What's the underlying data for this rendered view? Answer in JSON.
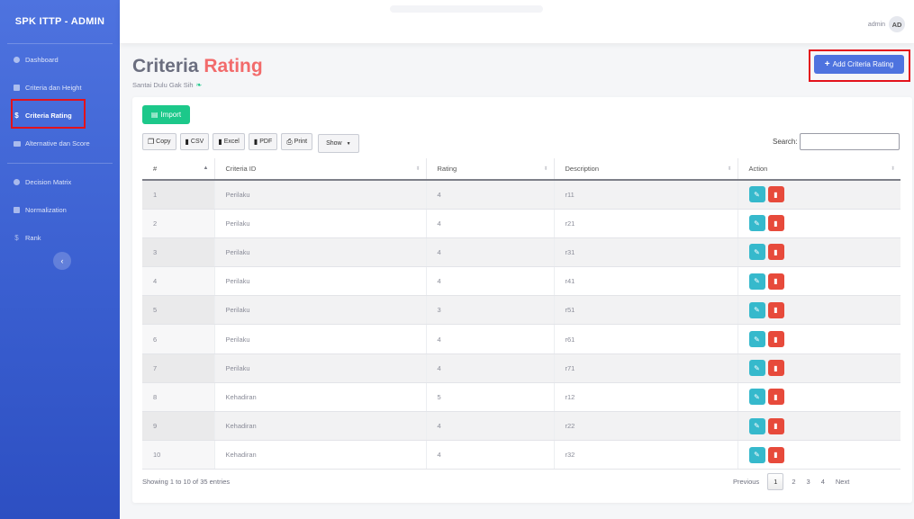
{
  "brand": "SPK ITTP - ADMIN",
  "sidebar": {
    "items": [
      {
        "label": "Dashboard",
        "icon": "dashboard-icon"
      },
      {
        "label": "Criteria dan Height",
        "icon": "table-icon"
      },
      {
        "label": "Criteria Rating",
        "icon": "dollar-icon"
      },
      {
        "label": "Alternative dan Score",
        "icon": "card-icon"
      },
      {
        "label": "Decision Matrix",
        "icon": "matrix-icon"
      },
      {
        "label": "Normalization",
        "icon": "table-icon"
      },
      {
        "label": "Rank",
        "icon": "dollar-icon"
      }
    ],
    "active": "Criteria Rating",
    "toggle_glyph": "‹"
  },
  "topbar": {
    "user_name": "admin",
    "avatar_initials": "AD"
  },
  "header": {
    "title_part1": "Criteria",
    "title_part2": "Rating",
    "subtitle": "Santai Dulu Gak Sih",
    "add_label": "Add Criteria Rating"
  },
  "toolbar": {
    "import_label": "Import",
    "buttons": [
      "Copy",
      "CSV",
      "Excel",
      "PDF",
      "Print"
    ],
    "show_label": "Show",
    "search_label": "Search:",
    "search_value": ""
  },
  "table": {
    "columns": [
      "#",
      "Criteria ID",
      "Rating",
      "Description",
      "Action"
    ],
    "rows": [
      {
        "no": "1",
        "criteria": "Perilaku",
        "rating": "4",
        "desc": "r11"
      },
      {
        "no": "2",
        "criteria": "Perilaku",
        "rating": "4",
        "desc": "r21"
      },
      {
        "no": "3",
        "criteria": "Perilaku",
        "rating": "4",
        "desc": "r31"
      },
      {
        "no": "4",
        "criteria": "Perilaku",
        "rating": "4",
        "desc": "r41"
      },
      {
        "no": "5",
        "criteria": "Perilaku",
        "rating": "3",
        "desc": "r51"
      },
      {
        "no": "6",
        "criteria": "Perilaku",
        "rating": "4",
        "desc": "r61"
      },
      {
        "no": "7",
        "criteria": "Perilaku",
        "rating": "4",
        "desc": "r71"
      },
      {
        "no": "8",
        "criteria": "Kehadiran",
        "rating": "5",
        "desc": "r12"
      },
      {
        "no": "9",
        "criteria": "Kehadiran",
        "rating": "4",
        "desc": "r22"
      },
      {
        "no": "10",
        "criteria": "Kehadiran",
        "rating": "4",
        "desc": "r32"
      }
    ]
  },
  "footer": {
    "info": "Showing 1 to 10 of 35 entries",
    "prev": "Previous",
    "pages": [
      "1",
      "2",
      "3",
      "4"
    ],
    "current_page": "1",
    "next": "Next"
  },
  "colors": {
    "primary": "#4e73df",
    "success": "#1cc88a",
    "info": "#36b9cc",
    "danger": "#e74a3b",
    "title_accent": "#f26b6b",
    "highlight_box": "#e3121b"
  }
}
